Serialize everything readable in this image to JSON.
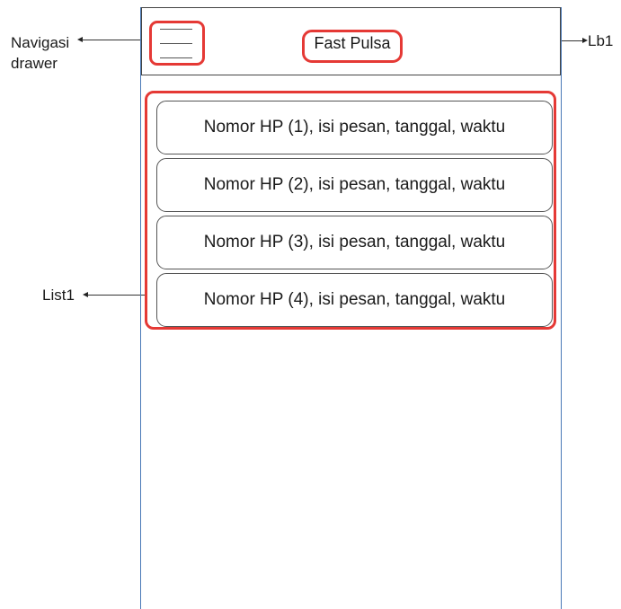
{
  "app": {
    "title": "Fast Pulsa"
  },
  "callouts": {
    "navigation_drawer_line1": "Navigasi",
    "navigation_drawer_line2": "drawer",
    "title_label": "Lb1",
    "list_label": "List1"
  },
  "messages": [
    {
      "text": "Nomor HP (1), isi pesan, tanggal, waktu"
    },
    {
      "text": "Nomor HP (2), isi pesan, tanggal, waktu"
    },
    {
      "text": "Nomor HP (3), isi pesan, tanggal, waktu"
    },
    {
      "text": "Nomor HP (4), isi pesan, tanggal, waktu"
    }
  ],
  "colors": {
    "highlight": "#e53935",
    "frame_border": "#4a79b7",
    "item_border": "#555555"
  },
  "icons": {
    "menu": "hamburger-menu-icon"
  }
}
